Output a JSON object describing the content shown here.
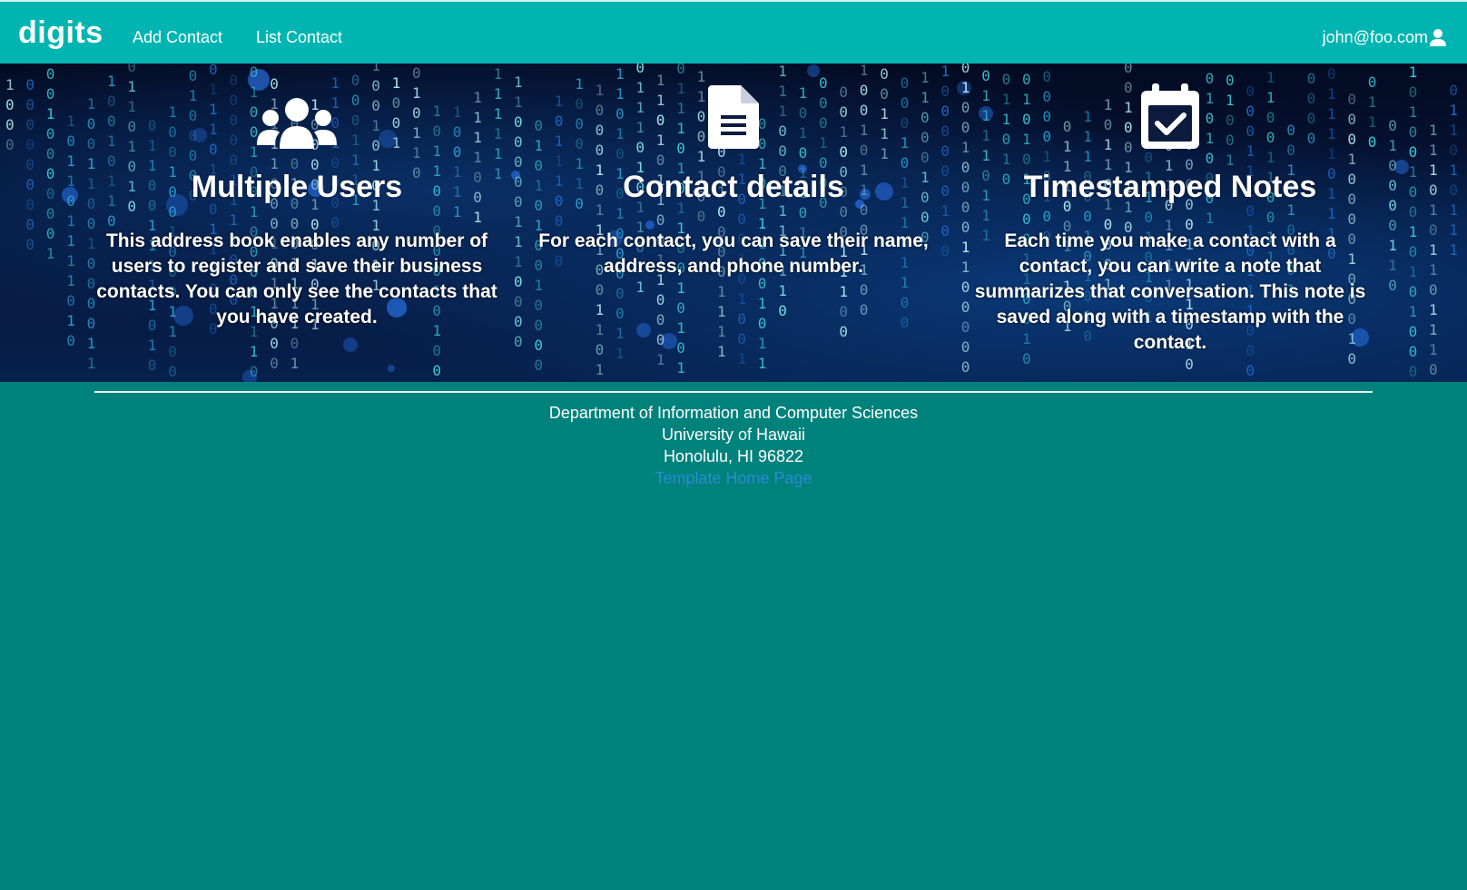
{
  "nav": {
    "brand": "digits",
    "links": [
      {
        "label": "Add Contact"
      },
      {
        "label": "List Contact"
      }
    ],
    "user": {
      "email": "john@foo.com",
      "icon": "user-icon"
    }
  },
  "features": [
    {
      "icon": "users-icon",
      "title": "Multiple Users",
      "text": "This address book enables any number of users to register and save their business contacts. You can only see the contacts that you have created."
    },
    {
      "icon": "file-icon",
      "title": "Contact details",
      "text": "For each contact, you can save their name, address, and phone number."
    },
    {
      "icon": "calendar-check-icon",
      "title": "Timestamped Notes",
      "text": "Each time you make a contact with a contact, you can write a note that summarizes that conversation. This note is saved along with a timestamp with the contact."
    }
  ],
  "footer": {
    "lines": [
      "Department of Information and Computer Sciences",
      "University of Hawaii",
      "Honolulu, HI 96822"
    ],
    "link_label": "Template Home Page"
  },
  "colors": {
    "navbar": "#00b5b1",
    "page_background": "#00827c",
    "footer_link": "#2a8bd6",
    "hero_background": "#06183f"
  }
}
